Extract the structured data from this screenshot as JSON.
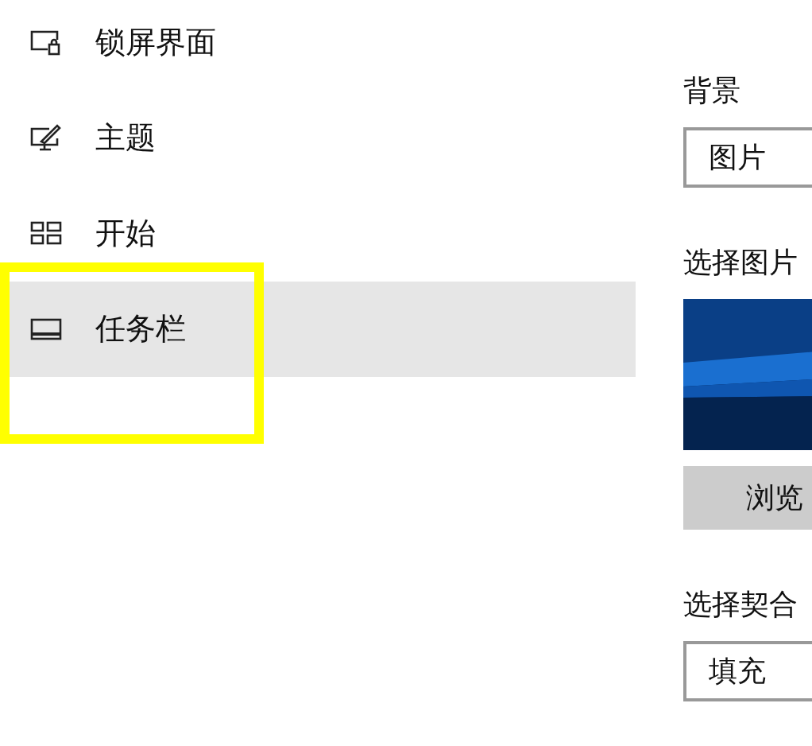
{
  "sidebar": {
    "items": [
      {
        "label": "锁屏界面",
        "kind": "lock",
        "selected": false
      },
      {
        "label": "主题",
        "kind": "theme",
        "selected": false
      },
      {
        "label": "开始",
        "kind": "start",
        "selected": false
      },
      {
        "label": "任务栏",
        "kind": "taskbar",
        "selected": true
      }
    ]
  },
  "content": {
    "background": {
      "label": "背景",
      "value": "图片"
    },
    "choose_picture": {
      "label": "选择图片",
      "browse_button": "浏览"
    },
    "fit": {
      "label": "选择契合",
      "value": "填充"
    }
  }
}
